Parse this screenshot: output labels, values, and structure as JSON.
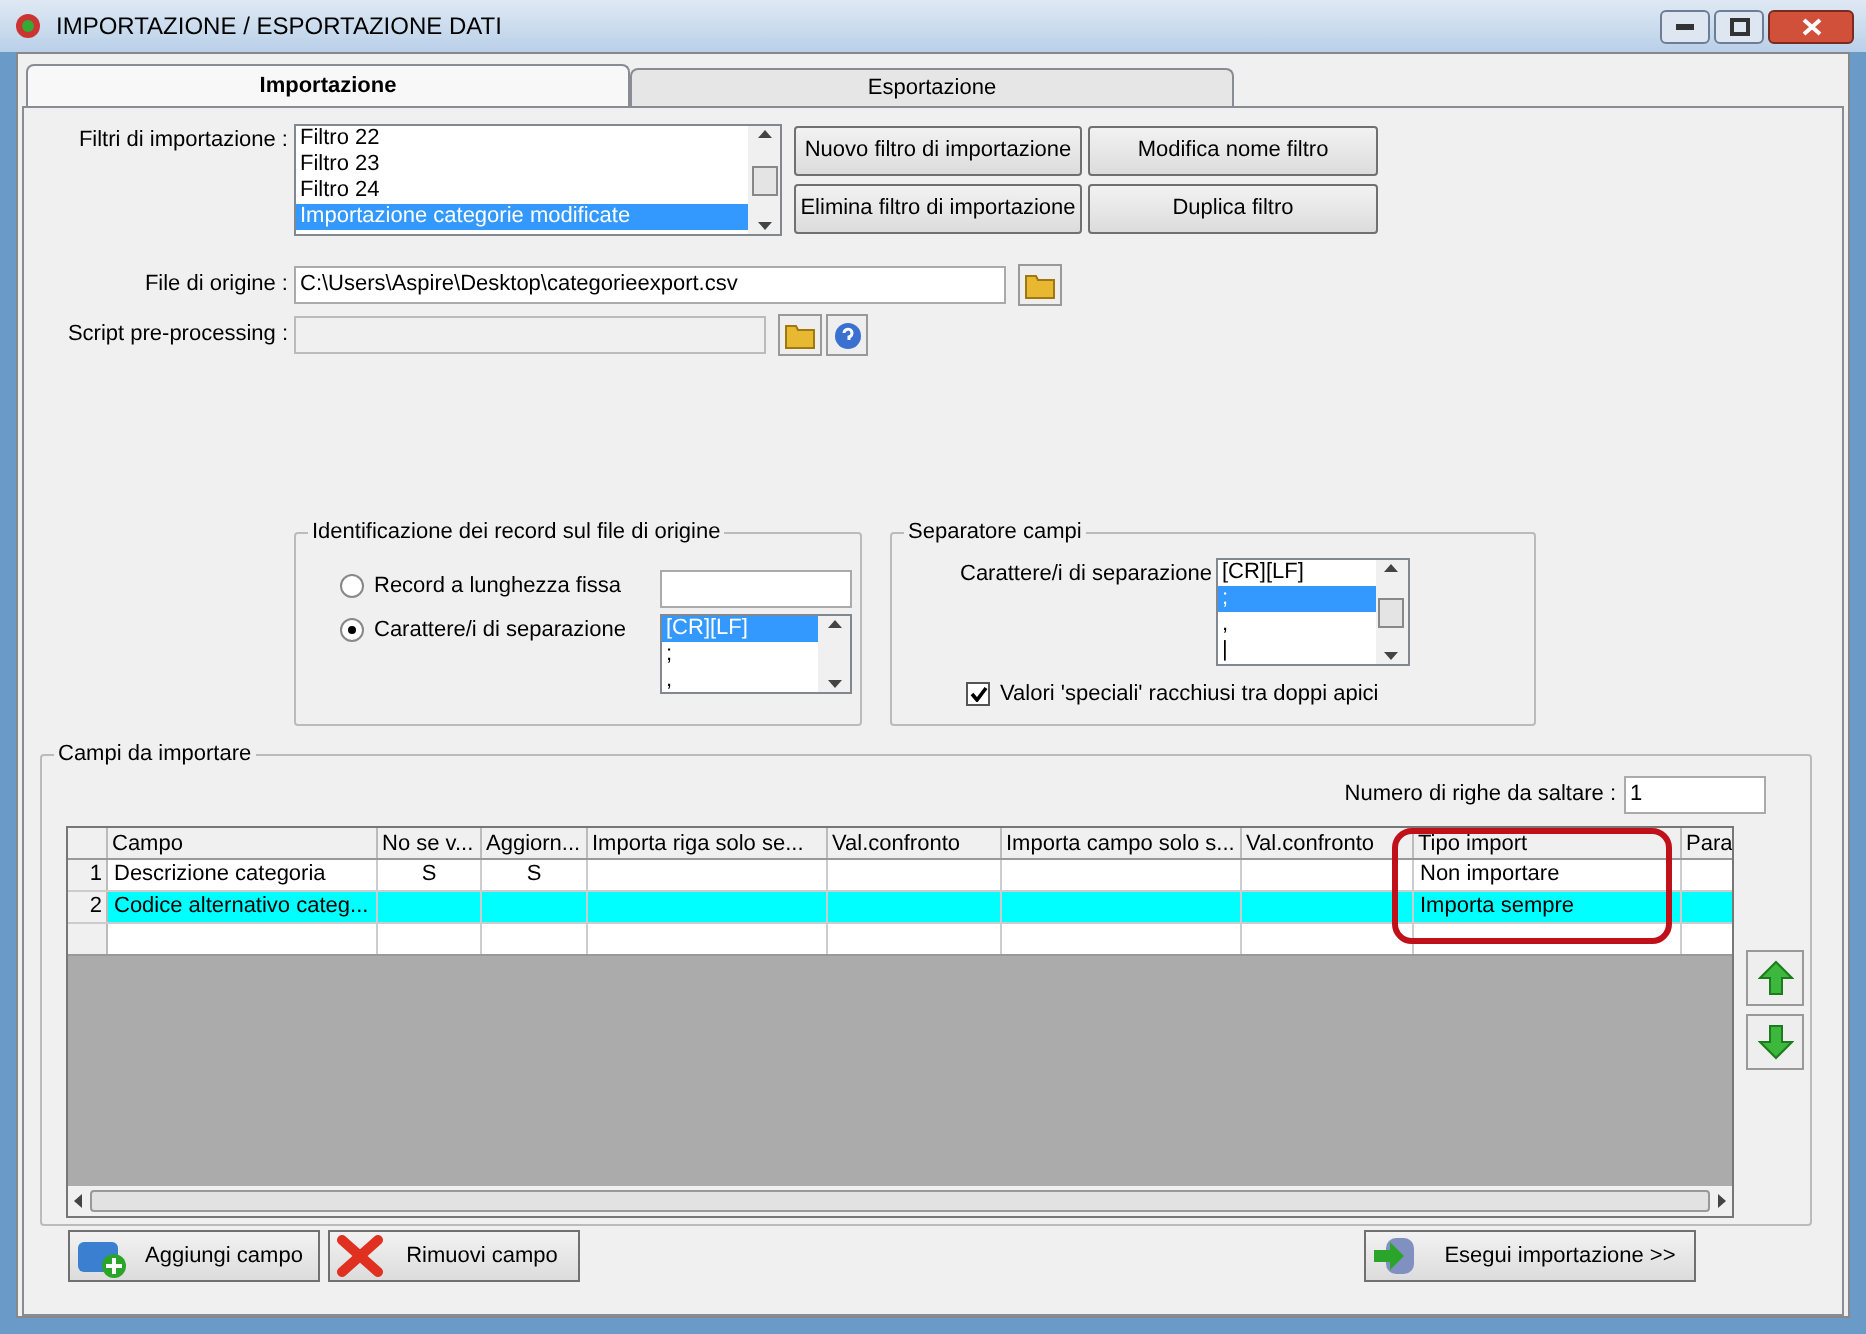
{
  "window": {
    "title": "IMPORTAZIONE / ESPORTAZIONE DATI"
  },
  "tabs": [
    {
      "label": "Importazione",
      "selected": true
    },
    {
      "label": "Esportazione",
      "selected": false
    }
  ],
  "import_filters": {
    "label": "Filtri di importazione :",
    "items": [
      {
        "label": "Filtro 22",
        "selected": false
      },
      {
        "label": "Filtro 23",
        "selected": false
      },
      {
        "label": "Filtro 24",
        "selected": false
      },
      {
        "label": "Importazione categorie modificate",
        "selected": true
      }
    ]
  },
  "filter_buttons": [
    "Nuovo filtro di importazione",
    "Modifica nome filtro",
    "Elimina filtro di importazione",
    "Duplica filtro"
  ],
  "source_file": {
    "label": "File di origine :",
    "value": "C:\\Users\\Aspire\\Desktop\\categorieexport.csv"
  },
  "script": {
    "label": "Script pre-processing :"
  },
  "record_identification": {
    "title": "Identificazione dei record sul file di origine",
    "options": [
      {
        "label": "Record a lunghezza fissa",
        "selected": false
      },
      {
        "label": "Carattere/i di separazione",
        "selected": true
      }
    ],
    "separators": [
      {
        "label": "[CR][LF]",
        "selected": true
      },
      {
        "label": ";",
        "selected": false
      },
      {
        "label": ",",
        "selected": false
      }
    ]
  },
  "field_separator": {
    "title": "Separatore campi",
    "label": "Carattere/i di separazione",
    "items": [
      {
        "label": "[CR][LF]",
        "selected": false
      },
      {
        "label": ";",
        "selected": true
      },
      {
        "label": ",",
        "selected": false
      },
      {
        "label": "|",
        "selected": false
      }
    ],
    "quotes": {
      "label": "Valori 'speciali' racchiusi tra doppi apici",
      "checked": true
    }
  },
  "fields": {
    "title": "Campi da importare",
    "skip_rows": {
      "label": "Numero di righe da saltare  :",
      "value": "1"
    },
    "columns": [
      "Campo",
      "No se v...",
      "Aggiorn...",
      "Importa riga solo se...",
      "Val.confronto",
      "Importa campo solo s...",
      "Val.confronto",
      "Tipo import",
      "Para"
    ],
    "rows": [
      {
        "number": "1",
        "selected": false,
        "cells": [
          "Descrizione categoria",
          "S",
          "S",
          null,
          null,
          null,
          null,
          "Non importare",
          null
        ]
      },
      {
        "number": "2",
        "selected": true,
        "cells": [
          "Codice alternativo categ...",
          null,
          null,
          null,
          null,
          null,
          null,
          "Importa sempre",
          null
        ]
      }
    ]
  },
  "bottom_buttons": [
    {
      "kind": "add",
      "label": "Aggiungi campo"
    },
    {
      "kind": "remove",
      "label": "Rimuovi campo"
    },
    {
      "kind": "run",
      "label": "Esegui importazione >>"
    }
  ]
}
